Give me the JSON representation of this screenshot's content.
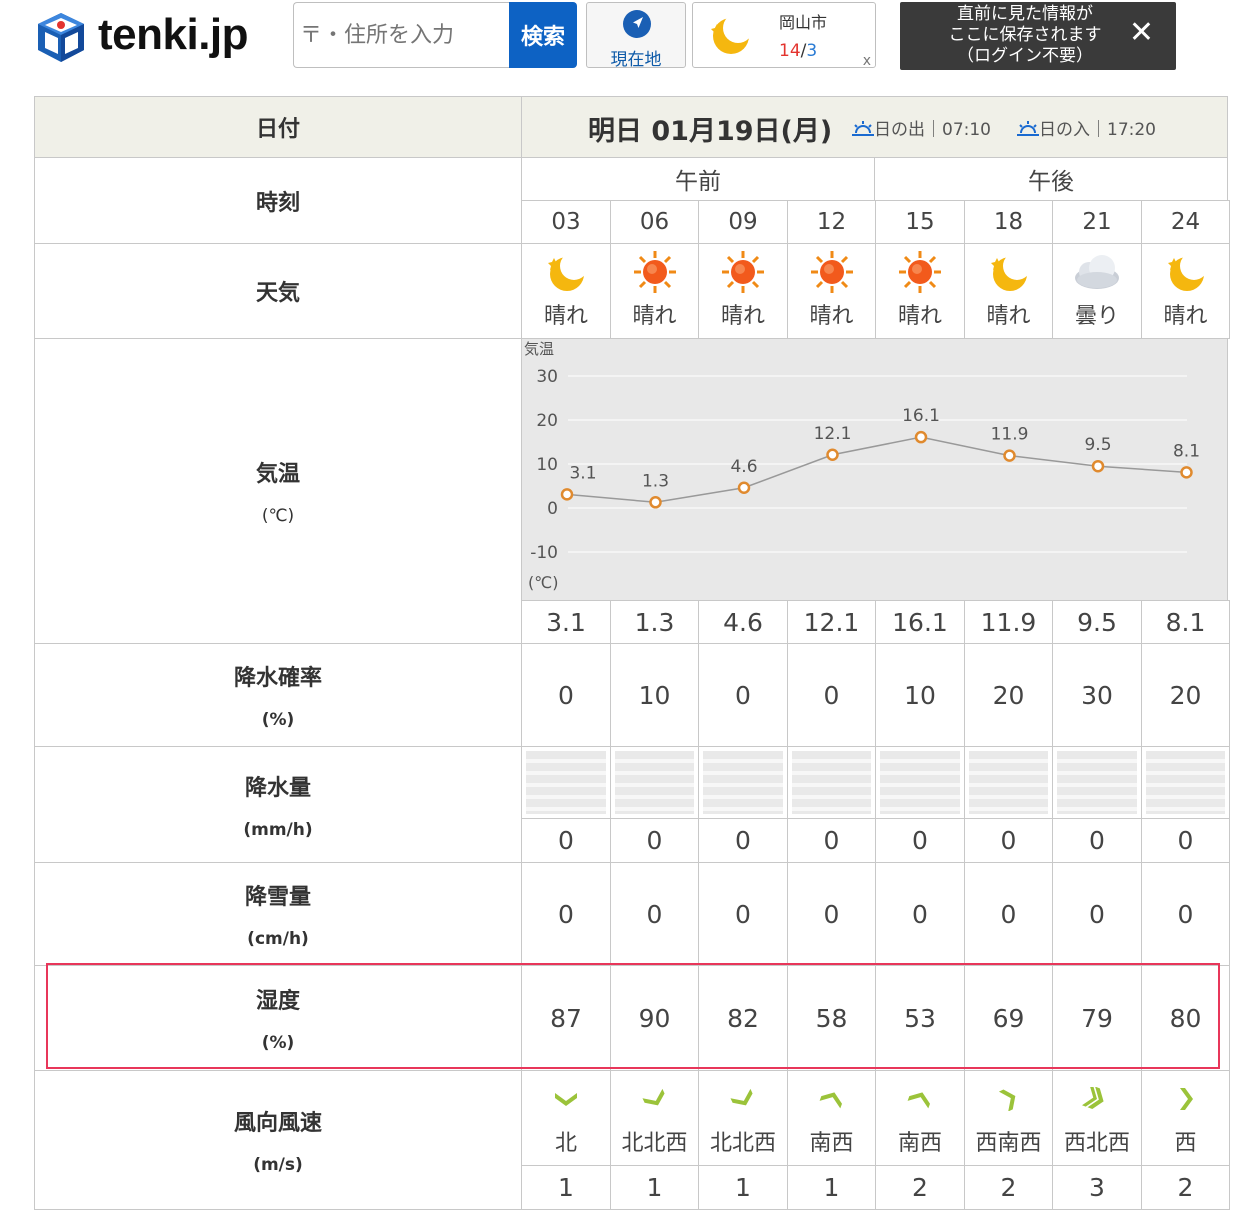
{
  "header": {
    "logo_text": "tenki.jp",
    "search_placeholder": "〒・住所を入力",
    "search_button": "検索",
    "current_location": "現在地",
    "history": {
      "city": "岡山市",
      "high": "14",
      "slash": "/",
      "low": "3",
      "close": "x"
    },
    "save_notice": [
      "直前に見た情報が",
      "ここに保存されます",
      "（ログイン不要）"
    ],
    "save_close": "✕"
  },
  "table": {
    "date_label": "日付",
    "date_value": "明日 01月19日(月)",
    "sunrise": "日の出｜07:10",
    "sunset": "日の入｜17:20",
    "time_label": "時刻",
    "am": "午前",
    "pm": "午後",
    "hours": [
      "03",
      "06",
      "09",
      "12",
      "15",
      "18",
      "21",
      "24"
    ],
    "weather_label": "天気",
    "weather": [
      {
        "icon": "moon-clear-icon",
        "text": "晴れ"
      },
      {
        "icon": "sun-icon",
        "text": "晴れ"
      },
      {
        "icon": "sun-icon",
        "text": "晴れ"
      },
      {
        "icon": "sun-icon",
        "text": "晴れ"
      },
      {
        "icon": "sun-icon",
        "text": "晴れ"
      },
      {
        "icon": "moon-clear-icon",
        "text": "晴れ"
      },
      {
        "icon": "cloud-icon",
        "text": "曇り"
      },
      {
        "icon": "moon-clear-icon",
        "text": "晴れ"
      }
    ],
    "temp_label": "気温",
    "temp_unit": "(℃)",
    "temps": [
      "3.1",
      "1.3",
      "4.6",
      "12.1",
      "16.1",
      "11.9",
      "9.5",
      "8.1"
    ],
    "precip_prob_label": "降水確率",
    "precip_prob_unit": "(%)",
    "precip_prob": [
      "0",
      "10",
      "0",
      "0",
      "10",
      "20",
      "30",
      "20"
    ],
    "precip_amount_label": "降水量",
    "precip_amount_unit": "(mm/h)",
    "precip_amount": [
      "0",
      "0",
      "0",
      "0",
      "0",
      "0",
      "0",
      "0"
    ],
    "snow_label": "降雪量",
    "snow_unit": "(cm/h)",
    "snow": [
      "0",
      "0",
      "0",
      "0",
      "0",
      "0",
      "0",
      "0"
    ],
    "humidity_label": "湿度",
    "humidity_unit": "(%)",
    "humidity": [
      "87",
      "90",
      "82",
      "58",
      "53",
      "69",
      "79",
      "80"
    ],
    "wind_label": "風向風速",
    "wind_unit": "(m/s)",
    "wind": [
      {
        "dir": "北",
        "speed": "1"
      },
      {
        "dir": "北北西",
        "speed": "1"
      },
      {
        "dir": "北北西",
        "speed": "1"
      },
      {
        "dir": "南西",
        "speed": "1"
      },
      {
        "dir": "南西",
        "speed": "2"
      },
      {
        "dir": "西南西",
        "speed": "2"
      },
      {
        "dir": "西北西",
        "speed": "3"
      },
      {
        "dir": "西",
        "speed": "2"
      }
    ]
  },
  "chart_data": {
    "type": "line",
    "ylabel": "気温",
    "yunit": "(℃)",
    "x": [
      "03",
      "06",
      "09",
      "12",
      "15",
      "18",
      "21",
      "24"
    ],
    "values": [
      3.1,
      1.3,
      4.6,
      12.1,
      16.1,
      11.9,
      9.5,
      8.1
    ],
    "yticks": [
      30,
      20,
      10,
      0,
      -10
    ],
    "ylim": [
      -10,
      30
    ],
    "grid": true,
    "point_color": "#e08a2e",
    "line_color": "#999999"
  },
  "colors": {
    "brand_blue": "#0d62c4",
    "highlight": "#e8365a",
    "wind_green": "#9bc33a"
  }
}
